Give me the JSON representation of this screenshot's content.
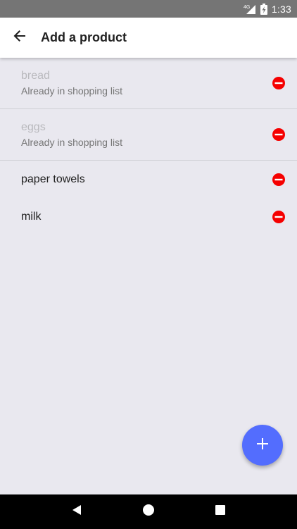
{
  "status_bar": {
    "network": "4G",
    "time": "1:33",
    "icons": [
      "signal-icon",
      "battery-charging-icon"
    ]
  },
  "app_bar": {
    "title": "Add a product",
    "back_icon": "arrow-back-icon"
  },
  "products": [
    {
      "name": "bread",
      "subtitle": "Already in shopping list",
      "in_list": true
    },
    {
      "name": "eggs",
      "subtitle": "Already in shopping list",
      "in_list": true
    },
    {
      "name": "paper towels",
      "subtitle": "",
      "in_list": false
    },
    {
      "name": "milk",
      "subtitle": "",
      "in_list": false
    }
  ],
  "remove_icon": "remove-circle-icon",
  "fab": {
    "icon": "add-icon"
  },
  "nav_bar": {
    "icons": [
      "back-triangle-icon",
      "home-circle-icon",
      "recents-square-icon"
    ]
  },
  "colors": {
    "background": "#e9e8ef",
    "accent": "#536dfe",
    "remove": "#f50000",
    "status_bar": "#757575"
  }
}
